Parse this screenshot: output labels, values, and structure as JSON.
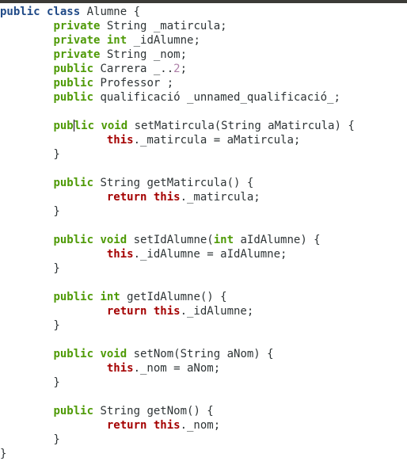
{
  "editor": {
    "language": "java",
    "lines": [
      [
        {
          "t": "public class",
          "c": "kw"
        },
        {
          "t": " Alumne {",
          "c": "p"
        }
      ],
      [
        {
          "t": "        ",
          "c": "p"
        },
        {
          "t": "private",
          "c": "kw2"
        },
        {
          "t": " String _matircula;",
          "c": "p"
        }
      ],
      [
        {
          "t": "        ",
          "c": "p"
        },
        {
          "t": "private int",
          "c": "kw2"
        },
        {
          "t": " _idAlumne;",
          "c": "p"
        }
      ],
      [
        {
          "t": "        ",
          "c": "p"
        },
        {
          "t": "private",
          "c": "kw2"
        },
        {
          "t": " String _nom;",
          "c": "p"
        }
      ],
      [
        {
          "t": "        ",
          "c": "p"
        },
        {
          "t": "public",
          "c": "kw2"
        },
        {
          "t": " Carrera _..",
          "c": "p"
        },
        {
          "t": "2",
          "c": "num"
        },
        {
          "t": ";",
          "c": "p"
        }
      ],
      [
        {
          "t": "        ",
          "c": "p"
        },
        {
          "t": "public",
          "c": "kw2"
        },
        {
          "t": " Professor ;",
          "c": "p"
        }
      ],
      [
        {
          "t": "        ",
          "c": "p"
        },
        {
          "t": "public",
          "c": "kw2"
        },
        {
          "t": " qualificació _unnamed_qualificació_;",
          "c": "p"
        }
      ],
      [],
      [
        {
          "t": "        ",
          "c": "p"
        },
        {
          "t": "pub",
          "c": "kw2"
        },
        {
          "t": "",
          "c": "cursor"
        },
        {
          "t": "lic void",
          "c": "kw2"
        },
        {
          "t": " setMatircula(String aMatircula) {",
          "c": "p"
        }
      ],
      [
        {
          "t": "                ",
          "c": "p"
        },
        {
          "t": "this",
          "c": "kwthis"
        },
        {
          "t": "._matircula = aMatircula;",
          "c": "p"
        }
      ],
      [
        {
          "t": "        }",
          "c": "p"
        }
      ],
      [],
      [
        {
          "t": "        ",
          "c": "p"
        },
        {
          "t": "public",
          "c": "kw2"
        },
        {
          "t": " String getMatircula() {",
          "c": "p"
        }
      ],
      [
        {
          "t": "                ",
          "c": "p"
        },
        {
          "t": "return this",
          "c": "kwthis"
        },
        {
          "t": "._matircula;",
          "c": "p"
        }
      ],
      [
        {
          "t": "        }",
          "c": "p"
        }
      ],
      [],
      [
        {
          "t": "        ",
          "c": "p"
        },
        {
          "t": "public void",
          "c": "kw2"
        },
        {
          "t": " setIdAlumne(",
          "c": "p"
        },
        {
          "t": "int",
          "c": "kw2"
        },
        {
          "t": " aIdAlumne) {",
          "c": "p"
        }
      ],
      [
        {
          "t": "                ",
          "c": "p"
        },
        {
          "t": "this",
          "c": "kwthis"
        },
        {
          "t": "._idAlumne = aIdAlumne;",
          "c": "p"
        }
      ],
      [
        {
          "t": "        }",
          "c": "p"
        }
      ],
      [],
      [
        {
          "t": "        ",
          "c": "p"
        },
        {
          "t": "public int",
          "c": "kw2"
        },
        {
          "t": " getIdAlumne() {",
          "c": "p"
        }
      ],
      [
        {
          "t": "                ",
          "c": "p"
        },
        {
          "t": "return this",
          "c": "kwthis"
        },
        {
          "t": "._idAlumne;",
          "c": "p"
        }
      ],
      [
        {
          "t": "        }",
          "c": "p"
        }
      ],
      [],
      [
        {
          "t": "        ",
          "c": "p"
        },
        {
          "t": "public void",
          "c": "kw2"
        },
        {
          "t": " setNom(String aNom) {",
          "c": "p"
        }
      ],
      [
        {
          "t": "                ",
          "c": "p"
        },
        {
          "t": "this",
          "c": "kwthis"
        },
        {
          "t": "._nom = aNom;",
          "c": "p"
        }
      ],
      [
        {
          "t": "        }",
          "c": "p"
        }
      ],
      [],
      [
        {
          "t": "        ",
          "c": "p"
        },
        {
          "t": "public",
          "c": "kw2"
        },
        {
          "t": " String getNom() {",
          "c": "p"
        }
      ],
      [
        {
          "t": "                ",
          "c": "p"
        },
        {
          "t": "return this",
          "c": "kwthis"
        },
        {
          "t": "._nom;",
          "c": "p"
        }
      ],
      [
        {
          "t": "        }",
          "c": "p"
        }
      ],
      [
        {
          "t": "}",
          "c": "p"
        }
      ]
    ]
  },
  "colors": {
    "background": "#ffffff",
    "keyword_class": "#204a87",
    "keyword": "#4e9a06",
    "keyword_this_return": "#a40000",
    "number": "#ad7fa8",
    "plain": "#2e3436"
  }
}
